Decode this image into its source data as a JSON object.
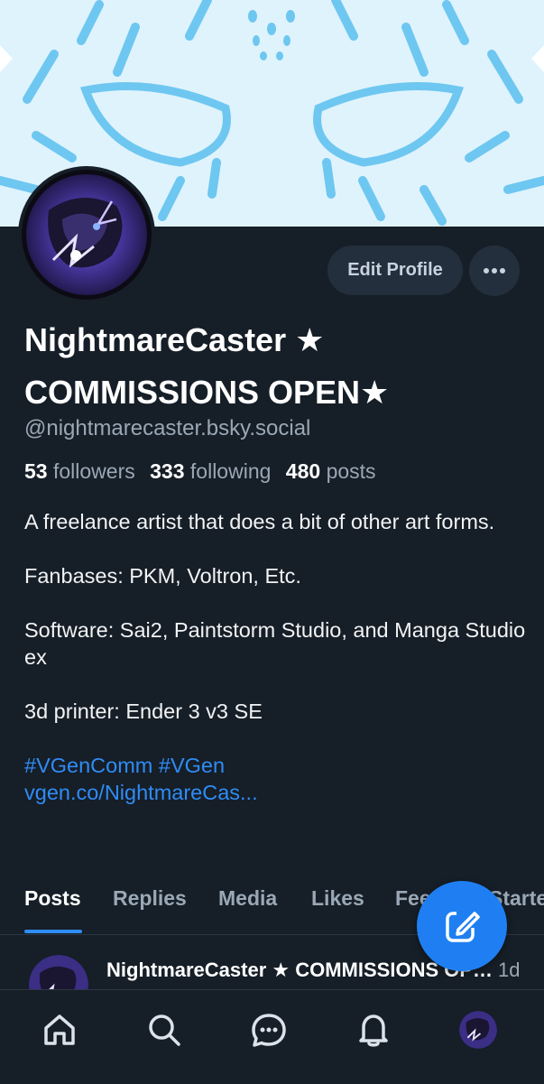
{
  "profile": {
    "display_name": "NightmareCaster ★ COMMISSIONS OPEN★",
    "handle": "@nightmarecaster.bsky.social",
    "followers_count": "53",
    "followers_label": "followers",
    "following_count": "333",
    "following_label": "following",
    "posts_count": "480",
    "posts_label": "posts",
    "edit_label": "Edit Profile",
    "bio": {
      "line1": "A freelance artist that does a bit of other art forms.",
      "line2": "Fanbases: PKM, Voltron, Etc.",
      "line3": "Software: Sai2, Paintstorm Studio, and Manga Studio ex",
      "line4": "3d printer: Ender 3 v3 SE",
      "hashtags": "#VGenComm #VGen",
      "link": "vgen.co/NightmareCas..."
    }
  },
  "tabs": [
    {
      "label": "Posts",
      "active": true
    },
    {
      "label": "Replies"
    },
    {
      "label": "Media"
    },
    {
      "label": "Likes"
    },
    {
      "label": "Feeds"
    },
    {
      "label": "Starter Packs"
    }
  ],
  "post": {
    "author": "NightmareCaster ★ COMMISSIONS OPEN★",
    "time": "1d"
  },
  "icons": {
    "more": "more-horizontal-icon",
    "compose": "compose-icon",
    "home": "home-icon",
    "search": "search-icon",
    "chat": "chat-icon",
    "notifications": "bell-icon"
  },
  "colors": {
    "background": "#161e27",
    "accent": "#2f8cf5",
    "banner": "#dff3fd",
    "banner_lines": "#6ec7f0"
  }
}
